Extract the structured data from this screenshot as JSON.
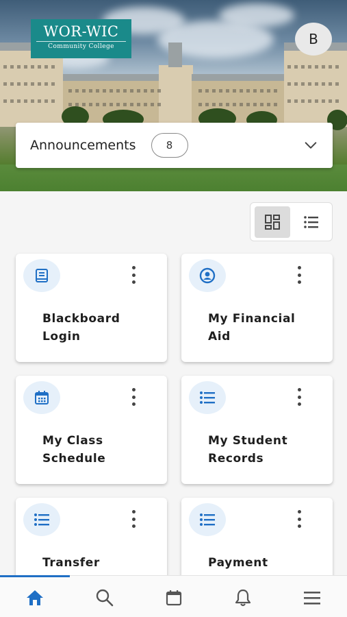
{
  "header": {
    "logo_line1": "WOR-WIC",
    "logo_line2": "Community College",
    "avatar_initial": "B"
  },
  "announcements": {
    "label": "Announcements",
    "count": "8"
  },
  "view_toggle": {
    "selected": "grid",
    "options": [
      "grid-view-icon",
      "list-view-icon"
    ]
  },
  "cards": [
    {
      "title": "Blackboard\nLogin",
      "icon": "book-icon"
    },
    {
      "title": "My Financial\nAid",
      "icon": "user-circle-icon"
    },
    {
      "title": "My Class\nSchedule",
      "icon": "calendar-icon"
    },
    {
      "title": "My Student\nRecords",
      "icon": "list-icon"
    },
    {
      "title": "Transfer",
      "icon": "list-icon"
    },
    {
      "title": "Payment",
      "icon": "list-icon"
    }
  ],
  "bottom_nav": {
    "items": [
      "home-icon",
      "search-icon",
      "calendar-icon",
      "notifications-icon",
      "menu-icon"
    ],
    "active": "home-icon"
  },
  "colors": {
    "accent": "#1f6fc5",
    "logo_bg": "#1a8a8a",
    "icon_bg": "#e6f0fa"
  }
}
